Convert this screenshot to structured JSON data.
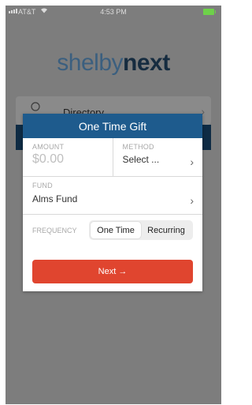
{
  "status_bar": {
    "carrier": "AT&T",
    "time": "4:53 PM",
    "battery_color": "#6ed14a"
  },
  "logo": {
    "part1": "shelby",
    "part2": "next"
  },
  "background_card": {
    "label": "Directory",
    "icon": "person-icon"
  },
  "modal": {
    "title": "One Time Gift",
    "amount_label": "AMOUNT",
    "amount_value": "$0.00",
    "method_label": "METHOD",
    "method_value": "Select ...",
    "fund_label": "FUND",
    "fund_value": "Alms Fund",
    "frequency_label": "FREQUENCY",
    "frequency_options": [
      "One Time",
      "Recurring"
    ],
    "frequency_selected": "One Time",
    "next_label": "Next →"
  },
  "colors": {
    "header_blue": "#1e5b8d",
    "next_red": "#e0452f",
    "overlay_gray": "#7d7d7d"
  }
}
